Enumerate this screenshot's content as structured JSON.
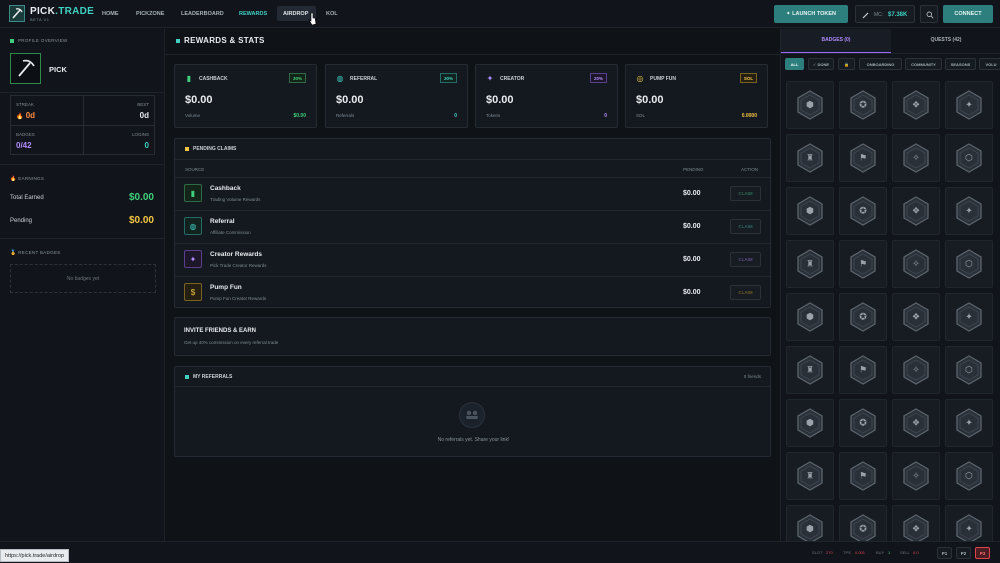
{
  "brand": {
    "name": "PICK",
    "dot": ".",
    "suffix": "TRADE",
    "badge": "BETA V1"
  },
  "nav": [
    "HOME",
    "PICKZONE",
    "LEADERBOARD",
    "REWARDS",
    "AIRDROP",
    "KOL"
  ],
  "header": {
    "launch": "LAUNCH TOKEN",
    "mc_label": "MC:",
    "mc_value": "$7.38K",
    "connect": "CONNECT"
  },
  "profile": {
    "section": "PROFILE OVERVIEW",
    "name": "PICK",
    "streak_label": "STREAK",
    "streak_value": "0d",
    "best_label": "BEST",
    "best_value": "0d",
    "badges_label": "BADGES",
    "badges_value": "0/42",
    "logins_label": "LOGINS",
    "logins_value": "0"
  },
  "earnings": {
    "section": "EARNINGS",
    "total_label": "Total Earned",
    "total_value": "$0.00",
    "pending_label": "Pending",
    "pending_value": "$0.00"
  },
  "recent": {
    "section": "RECENT BADGES",
    "empty": "No badges yet"
  },
  "main": {
    "title": "REWARDS & STATS"
  },
  "cards": [
    {
      "name": "CASHBACK",
      "pct": "30%",
      "value": "$0.00",
      "sub": "Volume",
      "sub_value": "$0.00",
      "color": "#3ecf7a",
      "icon": "▮"
    },
    {
      "name": "REFERRAL",
      "pct": "30%",
      "value": "$0.00",
      "sub": "Referrals",
      "sub_value": "0",
      "color": "#3fd0c2",
      "icon": "◍"
    },
    {
      "name": "CREATOR",
      "pct": "20%",
      "value": "$0.00",
      "sub": "Tokens",
      "sub_value": "0",
      "color": "#b08cff",
      "icon": "✦"
    },
    {
      "name": "PUMP FUN",
      "pct": "SOL",
      "value": "$0.00",
      "sub": "SOL",
      "sub_value": "0.0000",
      "color": "#f5c542",
      "icon": "◎"
    }
  ],
  "pending": {
    "title": "PENDING CLAIMS",
    "col_source": "SOURCE",
    "col_pending": "PENDING",
    "col_action": "ACTION",
    "rows": [
      {
        "title": "Cashback",
        "sub": "Trading Volume Rewards",
        "value": "$0.00",
        "action": "CLAIM",
        "color": "#3ecf7a",
        "icon": "▮"
      },
      {
        "title": "Referral",
        "sub": "Affiliate Commission",
        "value": "$0.00",
        "action": "CLAIM",
        "color": "#3fd0c2",
        "icon": "◍"
      },
      {
        "title": "Creator Rewards",
        "sub": "Pick Trade Creator Rewards",
        "value": "$0.00",
        "action": "CLAIM",
        "color": "#b08cff",
        "icon": "✦"
      },
      {
        "title": "Pump Fun",
        "sub": "Pump Fun Creator Rewards",
        "value": "$0.00",
        "action": "CLAIM",
        "color": "#f5c542",
        "icon": "$"
      }
    ]
  },
  "invite": {
    "title": "INVITE FRIENDS & EARN",
    "sub": "Get up 40% commission on every referral trade"
  },
  "referrals": {
    "title": "MY REFERRALS",
    "count": "0 friends",
    "empty": "No referrals yet. Share your link!"
  },
  "tabs": {
    "badges": "BADGES (0)",
    "quests": "QUESTS (42)"
  },
  "chips": [
    "ALL",
    "✓ DONE",
    "🔒",
    "ONBOARDING",
    "COMMUNITY",
    "SEASONS",
    "VOLU"
  ],
  "status": {
    "url": "https://pick.trade/airdrop",
    "s1_label": "SLOT",
    "s1_value": "270",
    "s2_label": "TPS",
    "s2_value": "0.001",
    "s3_label": "BUY",
    "s3_value": "1",
    "s4_label": "SELL",
    "s4_value": "0.0",
    "pages": [
      "P1",
      "P2",
      "P3"
    ]
  }
}
